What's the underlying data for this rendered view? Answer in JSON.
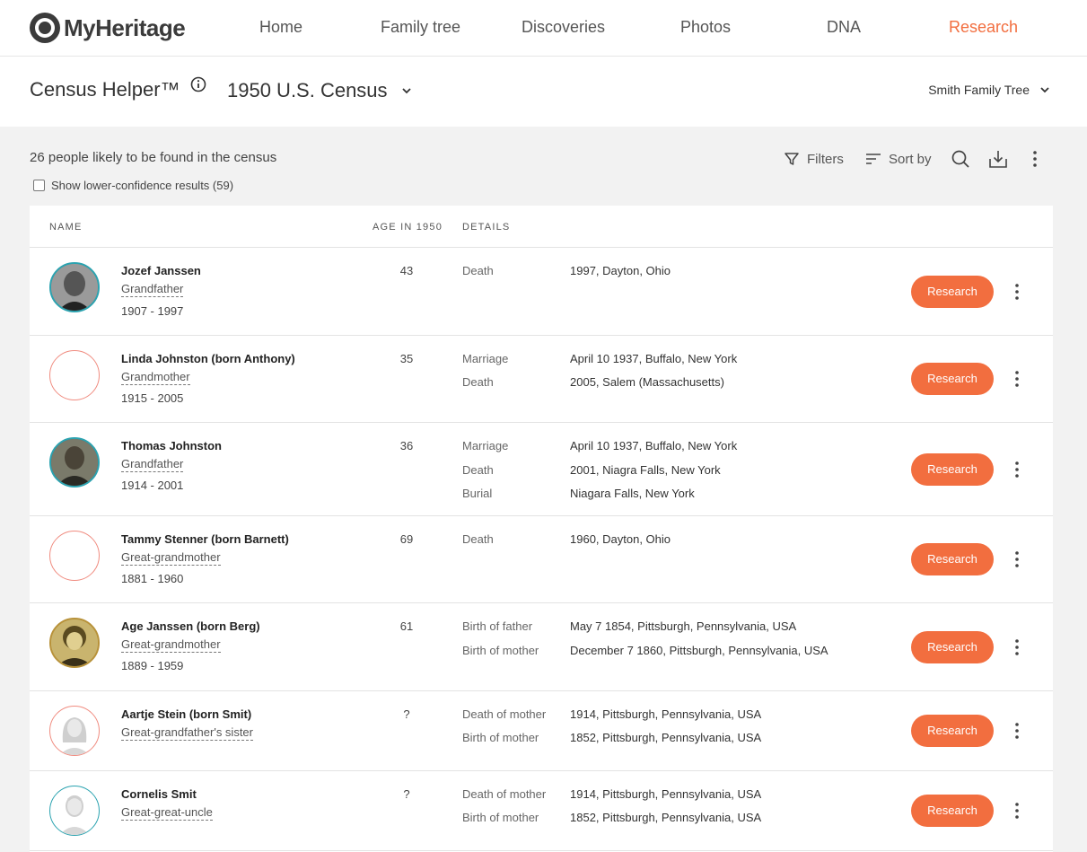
{
  "brand": {
    "name": "MyHeritage",
    "accent": "#f26e3f"
  },
  "nav": {
    "home": "Home",
    "family_tree": "Family tree",
    "discoveries": "Discoveries",
    "photos": "Photos",
    "dna": "DNA",
    "research": "Research"
  },
  "header": {
    "title": "Census Helper™",
    "census": "1950 U.S. Census",
    "tree": "Smith Family Tree"
  },
  "summary": {
    "count_text": "26 people likely to be found in the census",
    "lower_confidence": "Show lower-confidence results (59)"
  },
  "toolbar": {
    "filters": "Filters",
    "sort_by": "Sort by"
  },
  "table": {
    "col_name": "NAME",
    "col_age": "AGE IN 1950",
    "col_details": "DETAILS",
    "research_label": "Research",
    "rows": [
      {
        "name": "Jozef Janssen",
        "relation": "Grandfather",
        "years": "1907 - 1997",
        "age": "43",
        "events": [
          {
            "label": "Death",
            "value": "1997, Dayton, Ohio"
          }
        ]
      },
      {
        "name": "Linda Johnston (born Anthony)",
        "relation": "Grandmother",
        "years": "1915 - 2005",
        "age": "35",
        "events": [
          {
            "label": "Marriage",
            "value": "April 10 1937, Buffalo, New York"
          },
          {
            "label": "Death",
            "value": "2005, Salem (Massachusetts)"
          }
        ]
      },
      {
        "name": "Thomas Johnston",
        "relation": "Grandfather",
        "years": "1914 - 2001",
        "age": "36",
        "events": [
          {
            "label": "Marriage",
            "value": "April 10 1937, Buffalo, New York"
          },
          {
            "label": "Death",
            "value": "2001, Niagra Falls, New York"
          },
          {
            "label": "Burial",
            "value": "Niagara Falls, New York"
          }
        ]
      },
      {
        "name": "Tammy Stenner (born Barnett)",
        "relation": "Great-grandmother",
        "years": "1881 - 1960",
        "age": "69",
        "events": [
          {
            "label": "Death",
            "value": "1960, Dayton, Ohio"
          }
        ]
      },
      {
        "name": "Age Janssen (born Berg)",
        "relation": "Great-grandmother",
        "years": "1889 - 1959",
        "age": "61",
        "events": [
          {
            "label": "Birth of father",
            "value": "May 7 1854, Pittsburgh, Pennsylvania, USA"
          },
          {
            "label": "Birth of mother",
            "value": "December 7 1860, Pittsburgh, Pennsylvania, USA"
          }
        ]
      },
      {
        "name": "Aartje Stein (born Smit)",
        "relation": "Great-grandfather's sister",
        "years": "",
        "age": "?",
        "events": [
          {
            "label": "Death of mother",
            "value": "1914, Pittsburgh, Pennsylvania, USA"
          },
          {
            "label": "Birth of mother",
            "value": "1852, Pittsburgh, Pennsylvania, USA"
          }
        ]
      },
      {
        "name": "Cornelis Smit",
        "relation": "Great-great-uncle",
        "years": "",
        "age": "?",
        "events": [
          {
            "label": "Death of mother",
            "value": "1914, Pittsburgh, Pennsylvania, USA"
          },
          {
            "label": "Birth of mother",
            "value": "1852, Pittsburgh, Pennsylvania, USA"
          }
        ]
      }
    ]
  }
}
